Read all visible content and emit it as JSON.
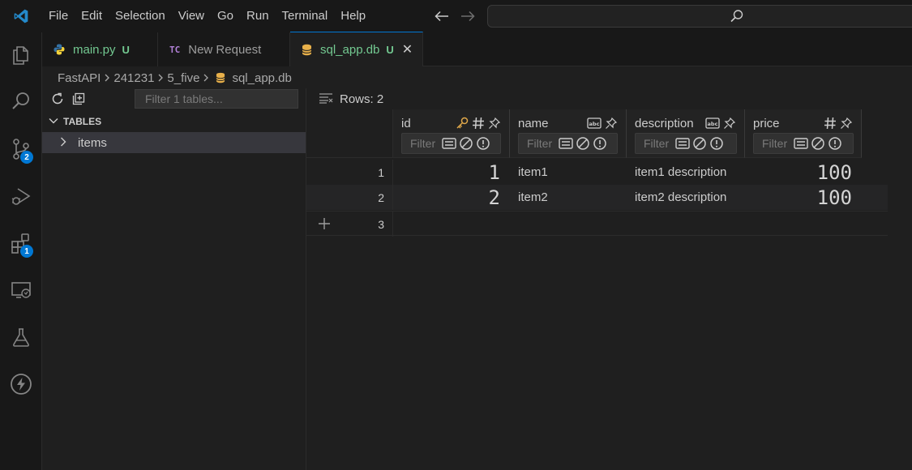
{
  "menu": [
    "File",
    "Edit",
    "Selection",
    "View",
    "Go",
    "Run",
    "Terminal",
    "Help"
  ],
  "colors": {
    "accent": "#0078d4",
    "git_untracked": "#73c991",
    "key": "#e0a84a",
    "db": "#e8b04a",
    "python_blue": "#3572a5",
    "python_yellow": "#f5d33b",
    "tc": "#b180d7"
  },
  "activity": {
    "scm_badge": "2",
    "extensions_badge": "1"
  },
  "tabs": [
    {
      "label": "main.py",
      "status": "U",
      "icon": "python-icon"
    },
    {
      "tc_badge": "TC",
      "label": "New Request",
      "icon": "thunder-client-icon"
    },
    {
      "label": "sql_app.db",
      "status": "U",
      "icon": "database-icon",
      "close": "✕"
    }
  ],
  "breadcrumb": [
    "FastAPI",
    "241231",
    "5_five",
    "sql_app.db"
  ],
  "tables_panel": {
    "filter_placeholder": "Filter 1 tables...",
    "header": "TABLES",
    "items": [
      "items"
    ]
  },
  "grid": {
    "rows_label": "Rows: 2",
    "filter_placeholder": "Filter",
    "columns": [
      {
        "name": "id",
        "type_icon": "#"
      },
      {
        "name": "name",
        "type_icon": "abc"
      },
      {
        "name": "description",
        "type_icon": "abc"
      },
      {
        "name": "price",
        "type_icon": "#"
      }
    ],
    "rows": [
      {
        "rownum": "1",
        "id": "1",
        "name": "item1",
        "description": "item1 description",
        "price": "100"
      },
      {
        "rownum": "2",
        "id": "2",
        "name": "item2",
        "description": "item2 description",
        "price": "100"
      }
    ],
    "new_rownum": "3"
  }
}
